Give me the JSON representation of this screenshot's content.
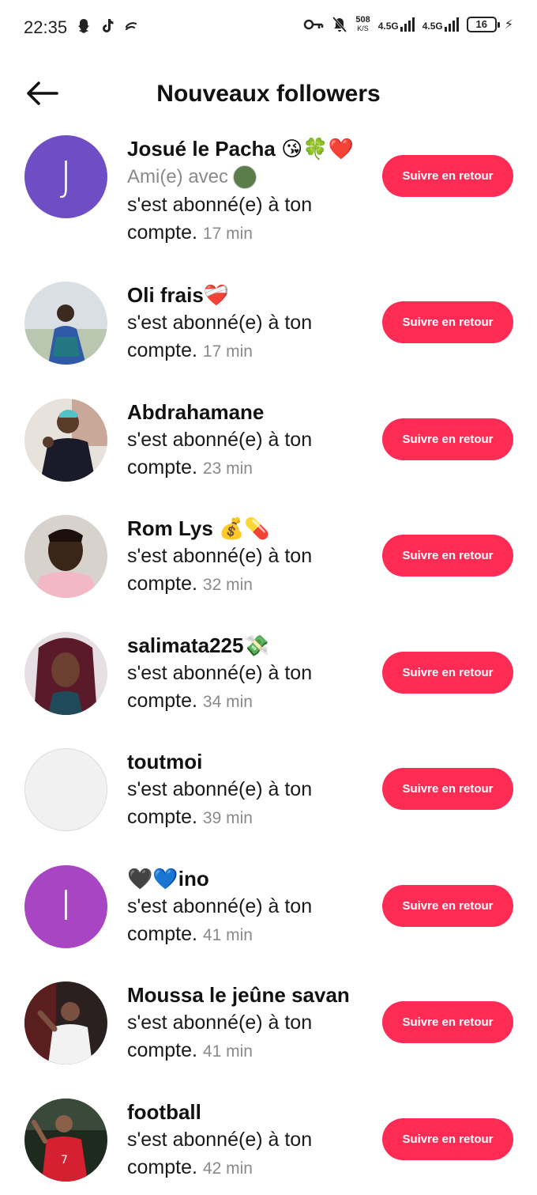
{
  "status_bar": {
    "time": "22:35",
    "net_speed_value": "508",
    "net_speed_unit": "K/S",
    "network_1": "4.5G",
    "network_2": "4.5G",
    "battery": "16"
  },
  "header": {
    "title": "Nouveaux followers"
  },
  "colors": {
    "accent": "#fe2c55"
  },
  "followers": [
    {
      "name": "Josué le Pacha 😘🍀❤️",
      "mutual_text": "Ami(e) avec",
      "action_text": "s'est abonné(e) à ton compte.",
      "time": "17 min",
      "button": "Suivre en retour",
      "avatar_letter": "J",
      "avatar_color": "#6f4dc4"
    },
    {
      "name": "Oli frais❤️‍🩹",
      "action_text": "s'est abonné(e) à ton compte.",
      "time": "17 min",
      "button": "Suivre en retour"
    },
    {
      "name": "Abdrahamane",
      "action_text": "s'est abonné(e) à ton compte.",
      "time": "23 min",
      "button": "Suivre en retour"
    },
    {
      "name": "Rom Lys 💰💊",
      "action_text": "s'est abonné(e) à ton compte.",
      "time": "32 min",
      "button": "Suivre en retour"
    },
    {
      "name": "salimata225💸",
      "action_text": "s'est abonné(e) à ton compte.",
      "time": "34 min",
      "button": "Suivre en retour"
    },
    {
      "name": "toutmoi",
      "action_text": "s'est abonné(e) à ton compte.",
      "time": "39 min",
      "button": "Suivre en retour"
    },
    {
      "name": "🖤💙ino",
      "action_text": "s'est abonné(e) à ton compte.",
      "time": "41 min",
      "button": "Suivre en retour",
      "avatar_letter": "I",
      "avatar_color": "#a845c2"
    },
    {
      "name": "Moussa le jeûne savan",
      "action_text": "s'est abonné(e) à ton compte.",
      "time": "41 min",
      "button": "Suivre en retour"
    },
    {
      "name": "football",
      "action_text": "s'est abonné(e) à ton compte.",
      "time": "42 min",
      "button": "Suivre en retour"
    }
  ]
}
